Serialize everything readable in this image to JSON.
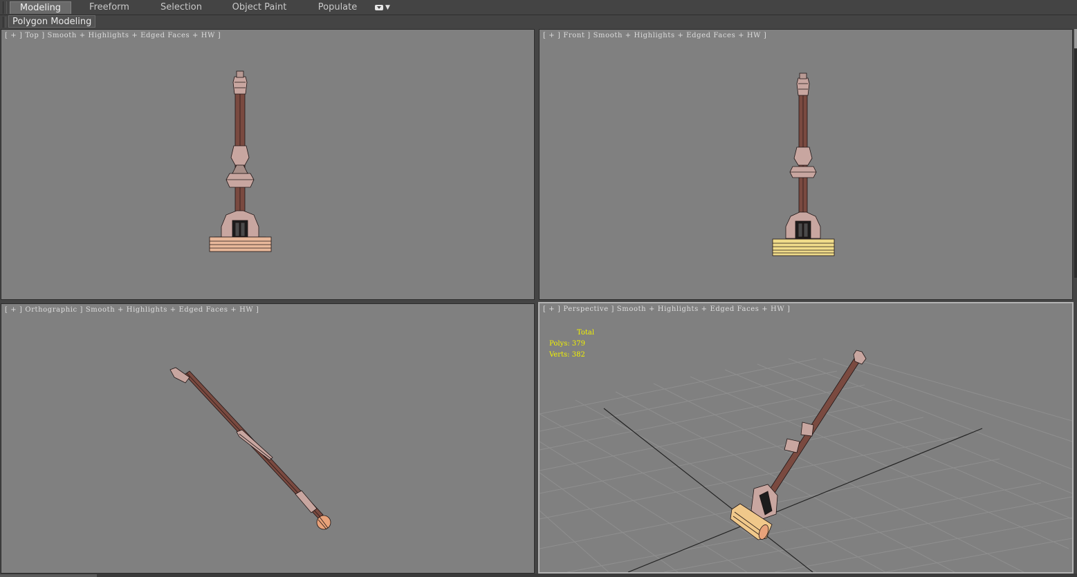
{
  "ribbon": {
    "tabs": [
      {
        "label": "Modeling",
        "active": true
      },
      {
        "label": "Freeform",
        "active": false
      },
      {
        "label": "Selection",
        "active": false
      },
      {
        "label": "Object Paint",
        "active": false
      },
      {
        "label": "Populate",
        "active": false
      }
    ],
    "panel_label": "Polygon Modeling"
  },
  "viewports": {
    "top": {
      "label": "[ + ] Top ] Smooth + Highlights + Edged Faces + HW ]"
    },
    "front": {
      "label": "[ + ] Front ] Smooth + Highlights + Edged Faces + HW ]"
    },
    "ortho": {
      "label": "[ + ] Orthographic ] Smooth + Highlights + Edged Faces + HW ]"
    },
    "perspective": {
      "label": "[ + ] Perspective ] Smooth + Highlights + Edged Faces + HW ]"
    }
  },
  "stats": {
    "header": "Total",
    "polys_label": "Polys:",
    "polys_value": "379",
    "verts_label": "Verts:",
    "verts_value": "382"
  },
  "colors": {
    "viewport_bg": "#808080",
    "model_shaft": "#7a4a40",
    "model_body": "#c8a6a0",
    "model_base_top": "#e8b89a",
    "model_base_front": "#f0dc8a",
    "stats_text": "#f2f200",
    "active_viewport_border": "#b4b4b4"
  }
}
